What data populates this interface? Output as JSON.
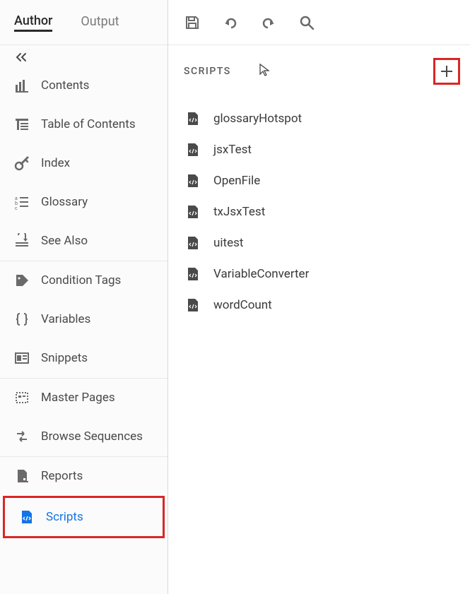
{
  "tabs": {
    "author": "Author",
    "output": "Output"
  },
  "sidebar": {
    "items": [
      {
        "label": "Contents"
      },
      {
        "label": "Table of Contents"
      },
      {
        "label": "Index"
      },
      {
        "label": "Glossary"
      },
      {
        "label": "See Also"
      },
      {
        "label": "Condition Tags"
      },
      {
        "label": "Variables"
      },
      {
        "label": "Snippets"
      },
      {
        "label": "Master Pages"
      },
      {
        "label": "Browse Sequences"
      },
      {
        "label": "Reports"
      },
      {
        "label": "Scripts"
      }
    ]
  },
  "panel": {
    "title": "SCRIPTS"
  },
  "scripts": [
    {
      "name": "glossaryHotspot"
    },
    {
      "name": "jsxTest"
    },
    {
      "name": "OpenFile"
    },
    {
      "name": "txJsxTest"
    },
    {
      "name": "uitest"
    },
    {
      "name": "VariableConverter"
    },
    {
      "name": "wordCount"
    }
  ]
}
